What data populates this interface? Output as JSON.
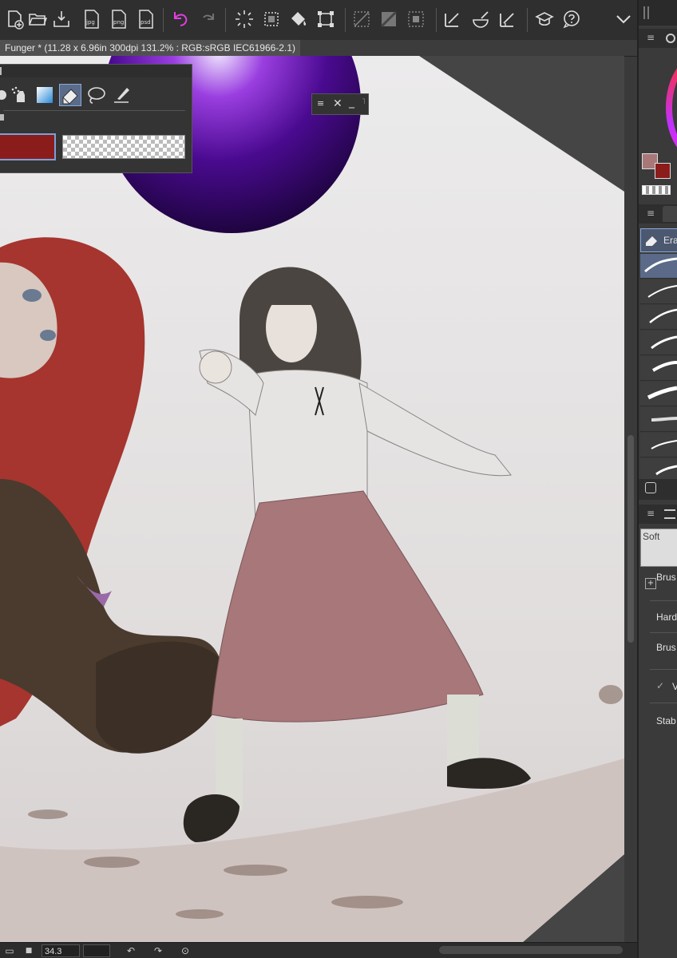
{
  "toolbar": {
    "icons": [
      "new-document",
      "open-folder",
      "save",
      "export-jpg",
      "export-png",
      "export-psd",
      "undo",
      "redo",
      "select-all",
      "deselect",
      "fill",
      "transform",
      "clear-outside",
      "hide-selection",
      "show-selection",
      "snap-ruler",
      "snap-special-ruler",
      "snap-grid",
      "learn",
      "help",
      "more"
    ],
    "export_jpg_label": "jpg",
    "export_png_label": "png",
    "export_psd_label": "psd",
    "undo_active_color": "#e040e0"
  },
  "document": {
    "title": "Funger * (11.28 x 6.96in 300dpi 131.2% : RGB:sRGB IEC61966-2.1)"
  },
  "palette": {
    "tools": [
      "hand",
      "airbrush",
      "gradient",
      "eraser",
      "lasso",
      "pen"
    ],
    "foreground_color": "#8b1c1c",
    "background": "transparent"
  },
  "dock": {
    "tool_label": "Era",
    "brush_preset_label": "Soft",
    "props": [
      "Brus",
      "Hard",
      "Brus",
      "V",
      "Stab"
    ],
    "main_color": "#a87878",
    "sub_color": "#8b1c1c"
  },
  "statusbar": {
    "zoom": "34.3"
  }
}
